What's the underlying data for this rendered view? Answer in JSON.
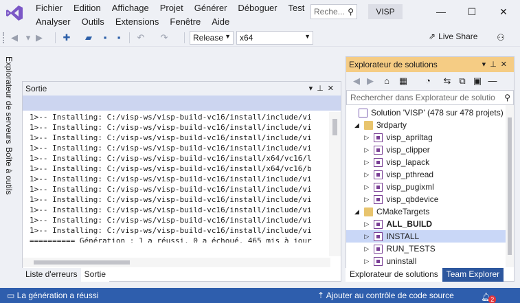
{
  "menu": {
    "row1": [
      "Fichier",
      "Edition",
      "Affichage",
      "Projet",
      "Générer",
      "Déboguer",
      "Test"
    ],
    "row2": [
      "Analyser",
      "Outils",
      "Extensions",
      "Fenêtre",
      "Aide"
    ]
  },
  "search": {
    "placeholder": "Reche..."
  },
  "solution_name": "VISP",
  "window_controls": {
    "minimize": "—",
    "maximize": "☐",
    "close": "✕"
  },
  "toolbar": {
    "config": "Release",
    "platform": "x64",
    "live_share": "Live Share"
  },
  "left_tabs": [
    "Explorateur de serveurs",
    "Boîte à outils"
  ],
  "output": {
    "title": "Sortie",
    "lines": [
      "1>-- Installing: C:/visp-ws/visp-build-vc16/install/include/vi",
      "1>-- Installing: C:/visp-ws/visp-build-vc16/install/include/vi",
      "1>-- Installing: C:/visp-ws/visp-build-vc16/install/include/vi",
      "1>-- Installing: C:/visp-ws/visp-build-vc16/install/include/vi",
      "1>-- Installing: C:/visp-ws/visp-build-vc16/install/x64/vc16/l",
      "1>-- Installing: C:/visp-ws/visp-build-vc16/install/x64/vc16/b",
      "1>-- Installing: C:/visp-ws/visp-build-vc16/install/include/vi",
      "1>-- Installing: C:/visp-ws/visp-build-vc16/install/include/vi",
      "1>-- Installing: C:/visp-ws/visp-build-vc16/install/include/vi",
      "1>-- Installing: C:/visp-ws/visp-build-vc16/install/include/vi",
      "1>-- Installing: C:/visp-ws/visp-build-vc16/install/include/vi",
      "1>-- Installing: C:/visp-ws/visp-build-vc16/install/include/vi",
      "========== Génération : 1 a réussi, 0 a échoué, 465 mis à jour"
    ],
    "tabs": [
      "Liste d'erreurs",
      "Sortie"
    ]
  },
  "solution_explorer": {
    "title": "Explorateur de solutions",
    "search_placeholder": "Rechercher dans Explorateur de solutio",
    "solution_label": "Solution 'VISP' (478 sur 478 projets)",
    "folder_3rdparty": "3rdparty",
    "items_3rdparty": [
      "visp_apriltag",
      "visp_clipper",
      "visp_lapack",
      "visp_pthread",
      "visp_pugixml",
      "visp_qbdevice"
    ],
    "folder_cmake": "CMakeTargets",
    "items_cmake": [
      "ALL_BUILD",
      "INSTALL",
      "RUN_TESTS",
      "uninstall"
    ],
    "tabs": [
      "Explorateur de solutions",
      "Team Explorer"
    ]
  },
  "status": {
    "left": "La génération a réussi",
    "right": "Ajouter au contrôle de code source",
    "notifications": "2"
  }
}
